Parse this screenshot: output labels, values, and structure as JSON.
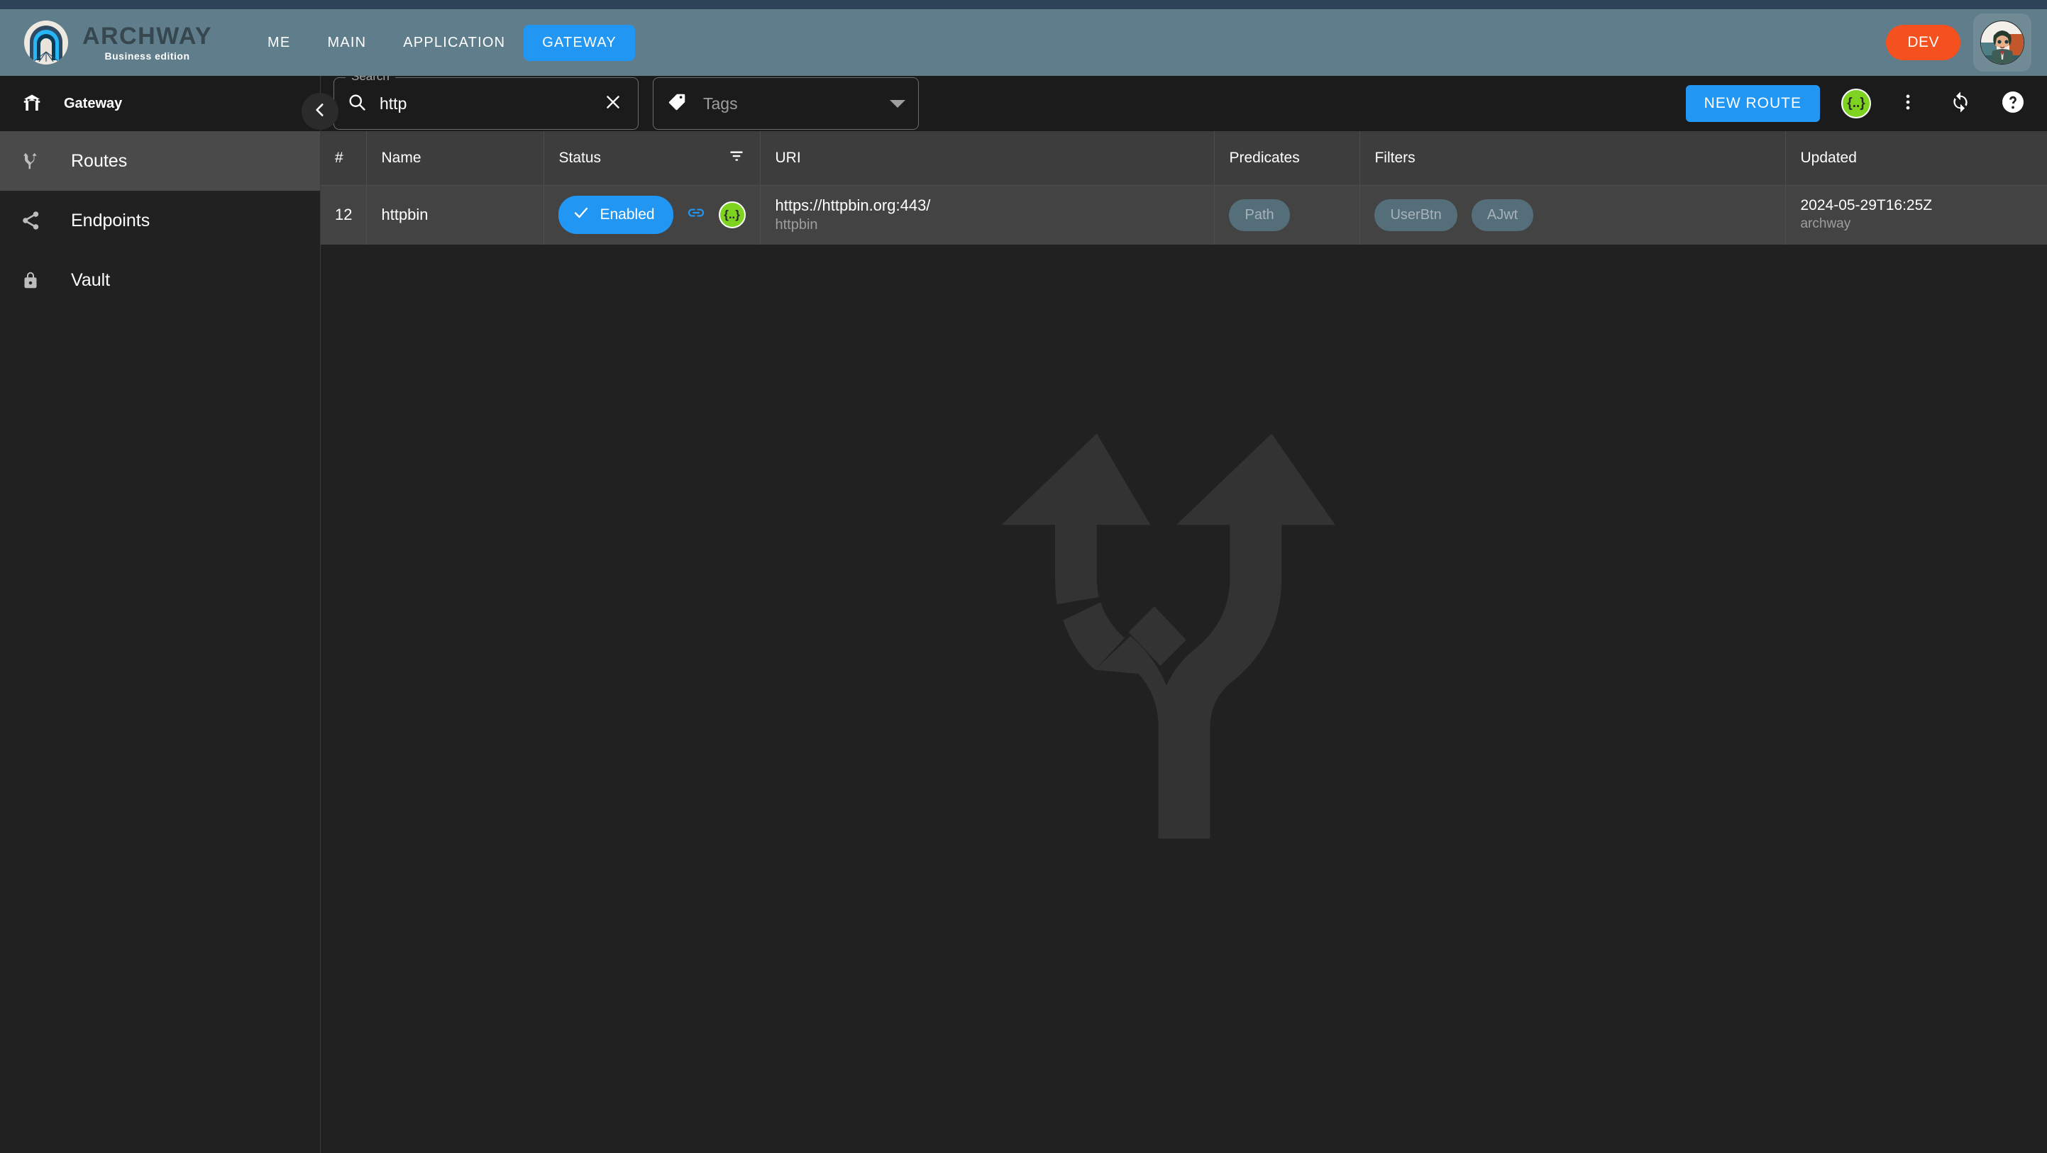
{
  "app": {
    "brand_title": "ARCHWAY",
    "brand_subtitle": "Business edition",
    "logo_icon": "archway-logo-icon"
  },
  "header": {
    "nav_items": [
      {
        "label": "ME",
        "active": false
      },
      {
        "label": "MAIN",
        "active": false
      },
      {
        "label": "APPLICATION",
        "active": false
      },
      {
        "label": "GATEWAY",
        "active": true
      }
    ],
    "env_badge": "DEV",
    "avatar_icon": "user-avatar",
    "accent_color": "#2196f3",
    "env_color": "#f4511e",
    "bar_color": "#607d8b"
  },
  "sidebar": {
    "section_title": "Gateway",
    "section_icon": "archway-gate-icon",
    "collapse_icon": "chevron-left-icon",
    "items": [
      {
        "label": "Routes",
        "icon": "route-fork-icon",
        "active": true
      },
      {
        "label": "Endpoints",
        "icon": "share-nodes-icon",
        "active": false
      },
      {
        "label": "Vault",
        "icon": "lock-icon",
        "active": false
      }
    ]
  },
  "toolbar": {
    "search": {
      "legend": "Search",
      "value": "http",
      "placeholder": "Search",
      "search_icon": "search-icon",
      "clear_icon": "close-icon"
    },
    "tags": {
      "label": "Tags",
      "icon": "tag-icon",
      "caret_icon": "chevron-down-icon"
    },
    "new_route_label": "NEW ROUTE",
    "json_badge_label": "{..}",
    "more_icon": "more-vertical-icon",
    "sync_icon": "sync-icon",
    "help_icon": "help-circle-icon"
  },
  "table": {
    "columns": [
      {
        "key": "num",
        "label": "#"
      },
      {
        "key": "name",
        "label": "Name"
      },
      {
        "key": "status",
        "label": "Status",
        "filter_icon": "filter-list-icon"
      },
      {
        "key": "uri",
        "label": "URI"
      },
      {
        "key": "predicates",
        "label": "Predicates"
      },
      {
        "key": "filters",
        "label": "Filters"
      },
      {
        "key": "updated",
        "label": "Updated"
      }
    ],
    "rows": [
      {
        "num": "12",
        "name": "httpbin",
        "status_label": "Enabled",
        "status_check_icon": "check-icon",
        "link_icon": "link-icon",
        "json_icon": "json-badge-icon",
        "uri_main": "https://httpbin.org:443/",
        "uri_sub": "httpbin",
        "predicates": [
          "Path"
        ],
        "filters": [
          "UserBtn",
          "AJwt"
        ],
        "updated_main": "2024-05-29T16:25Z",
        "updated_sub": "archway"
      }
    ]
  },
  "watermark": {
    "icon": "route-fork-watermark"
  }
}
